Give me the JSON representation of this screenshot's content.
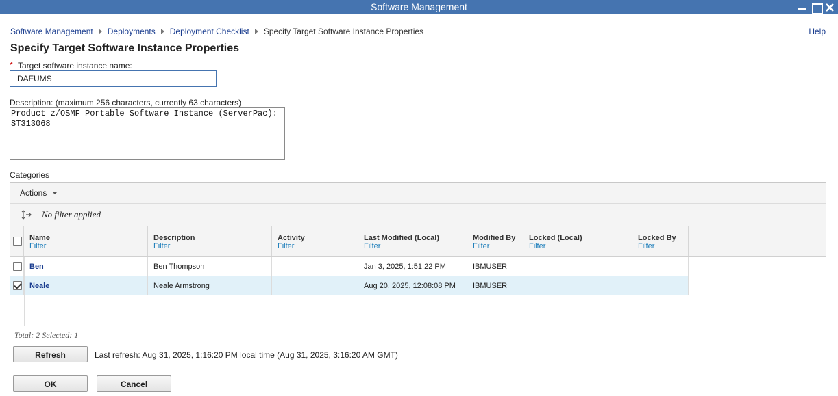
{
  "window": {
    "title": "Software Management"
  },
  "breadcrumb": {
    "items": [
      "Software Management",
      "Deployments",
      "Deployment Checklist"
    ],
    "current": "Specify Target Software Instance Properties"
  },
  "help_label": "Help",
  "page_title": "Specify Target Software Instance Properties",
  "name_field": {
    "required_marker": "*",
    "label": "Target software instance name:",
    "value": "DAFUMS"
  },
  "description_field": {
    "label": "Description: (maximum 256 characters, currently 63 characters)",
    "value": "Product z/OSMF Portable Software Instance (ServerPac):\nST313068"
  },
  "categories": {
    "label": "Categories",
    "actions_label": "Actions",
    "filter_status": "No filter applied",
    "columns": [
      {
        "name": "Name",
        "filter": "Filter"
      },
      {
        "name": "Description",
        "filter": "Filter"
      },
      {
        "name": "Activity",
        "filter": "Filter"
      },
      {
        "name": "Last Modified (Local)",
        "filter": "Filter"
      },
      {
        "name": "Modified By",
        "filter": "Filter"
      },
      {
        "name": "Locked (Local)",
        "filter": "Filter"
      },
      {
        "name": "Locked By",
        "filter": "Filter"
      }
    ],
    "rows": [
      {
        "checked": false,
        "name": "Ben",
        "description": "Ben Thompson",
        "activity": "",
        "last_modified": "Jan 3, 2025, 1:51:22 PM",
        "modified_by": "IBMUSER",
        "locked": "",
        "locked_by": ""
      },
      {
        "checked": true,
        "name": "Neale",
        "description": "Neale Armstrong",
        "activity": "",
        "last_modified": "Aug 20, 2025, 12:08:08 PM",
        "modified_by": "IBMUSER",
        "locked": "",
        "locked_by": ""
      }
    ],
    "total_text": "Total: 2 Selected: 1"
  },
  "refresh": {
    "button_label": "Refresh",
    "last_refresh_text": "Last refresh: Aug 31, 2025, 1:16:20 PM local time (Aug 31, 2025, 3:16:20 AM GMT)"
  },
  "footer": {
    "ok_label": "OK",
    "cancel_label": "Cancel"
  }
}
